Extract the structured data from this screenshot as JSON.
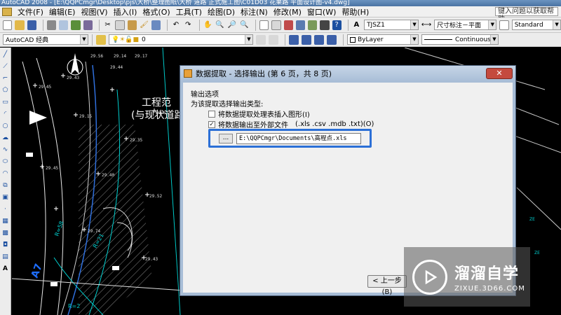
{
  "window": {
    "title": "AutoCAD 2008 - [E:\\QQPCmgr\\Desktop\\pjs\\大桥\\整理图纸\\大桥 道路 正式施工图\\C01D03 花果路 平面设计图-v4.dwg]"
  },
  "menubar": {
    "items": [
      "文件(F)",
      "编辑(E)",
      "视图(V)",
      "插入(I)",
      "格式(O)",
      "工具(T)",
      "绘图(D)",
      "标注(N)",
      "修改(M)",
      "窗口(W)",
      "帮助(H)"
    ],
    "help_search": "键入问题以获取帮助"
  },
  "toolbar": {
    "text_style": "TJSZ1",
    "dim_style": "尺寸标注－平面",
    "table_style": "Standard"
  },
  "toolbar2": {
    "workspace": "AutoCAD 经典",
    "layer": "0",
    "color": "ByLayer",
    "linetype": "Continuous"
  },
  "canvas": {
    "labels": [
      "工程范",
      "(与现状道路"
    ]
  },
  "dialog": {
    "title": "数据提取 - 选择输出 (第 6 页，共 8 页)",
    "close_label": "✕",
    "section_title": "输出选项",
    "section_prompt": "为该提取选择输出类型:",
    "option_table": {
      "label": "将数据提取处理表插入图形(I)",
      "checked": false
    },
    "option_file": {
      "label": "将数据输出至外部文件",
      "suffix": "(.xls .csv .mdb .txt)(O)",
      "checked": true
    },
    "browse_label": "...",
    "file_path": "E:\\QQPCmgr\\Documents\\高程点.xls",
    "back_label": "< 上一步(B)"
  },
  "watermark": {
    "title": "溜溜自学",
    "url": "ZIXUE.3D66.COM"
  }
}
